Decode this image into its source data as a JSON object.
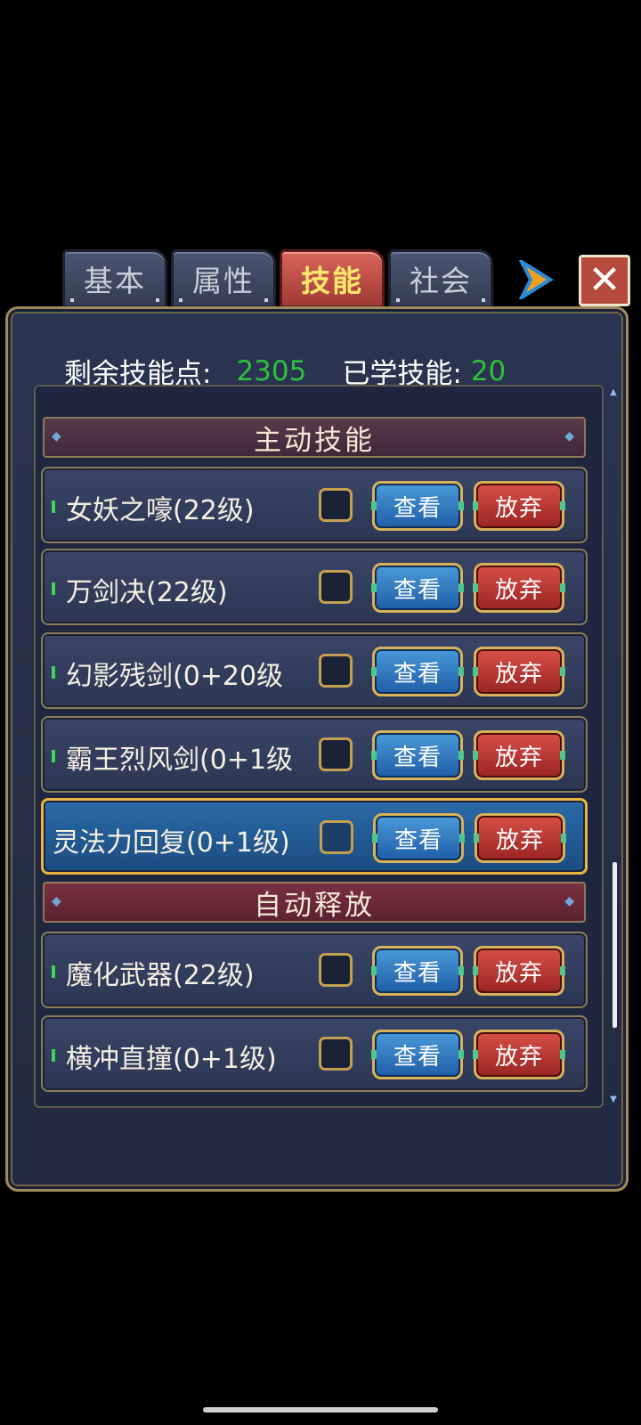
{
  "tabs": [
    {
      "label": "基本",
      "active": false
    },
    {
      "label": "属性",
      "active": false
    },
    {
      "label": "技能",
      "active": true
    },
    {
      "label": "社会",
      "active": false
    }
  ],
  "header": {
    "remaining_label": "剩余技能点:",
    "remaining_value": "2305",
    "learned_label": "已学技能:",
    "learned_value": "20"
  },
  "sections": {
    "active_title": "主动技能",
    "auto_title": "自动释放"
  },
  "buttons": {
    "view_label": "查看",
    "drop_label": "放弃"
  },
  "active_skills": [
    {
      "name": "女妖之嚎(22级)"
    },
    {
      "name": "万剑决(22级)"
    },
    {
      "name": "幻影残剑(0+20级"
    },
    {
      "name": "霸王烈风剑(0+1级"
    },
    {
      "name": "灵法力回复(0+1级)"
    }
  ],
  "auto_skills": [
    {
      "name": "魔化武器(22级)"
    },
    {
      "name": "横冲直撞(0+1级)"
    }
  ],
  "close_glyph": "✕",
  "colors": {
    "points_green": "#2fc03c",
    "active_tab_text": "#ffe96a",
    "selected_row_border": "#e7b640"
  },
  "scroll_position": 0.78
}
